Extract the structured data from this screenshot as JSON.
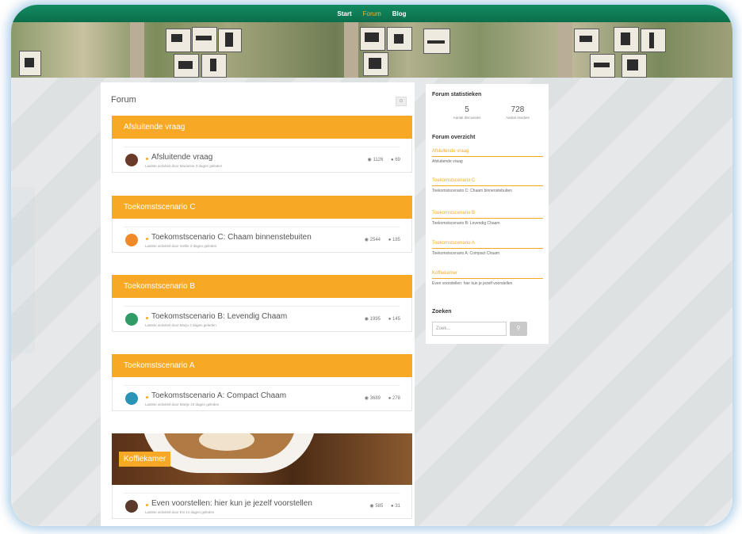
{
  "nav": {
    "items": [
      "Start",
      "Forum",
      "Blog"
    ],
    "active": "Forum"
  },
  "forum": {
    "title": "Forum",
    "rss_label": "rss",
    "categories": [
      {
        "name": "Afsluitende vraag",
        "topic": {
          "title": "Afsluitende vraag",
          "meta": "Laatste activiteit door Marianne 3 dagen geleden",
          "views": "1126",
          "replies": "69"
        }
      },
      {
        "name": "Toekomstscenario C",
        "topic": {
          "title": "Toekomstscenario C: Chaam binnenstebuiten",
          "meta": "Laatste activiteit door mellie 3 dagen geleden",
          "views": "2544",
          "replies": "185"
        }
      },
      {
        "name": "Toekomstscenario B",
        "topic": {
          "title": "Toekomstscenario B: Levendig Chaam",
          "meta": "Laatste activiteit door Marjo 3 dagen geleden",
          "views": "1995",
          "replies": "145"
        }
      },
      {
        "name": "Toekomstscenario A",
        "topic": {
          "title": "Toekomstscenario A: Compact Chaam",
          "meta": "Laatste activiteit door Marije 10 dagen geleden",
          "views": "3689",
          "replies": "278"
        }
      },
      {
        "name": "Koffiekamer",
        "topic": {
          "title": "Even voorstellen: hier kun je jezelf voorstellen",
          "meta": "Laatste activiteit door Evi 14 dagen geleden",
          "views": "585",
          "replies": "31"
        }
      }
    ]
  },
  "sidebar": {
    "stats_heading": "Forum statistieken",
    "discussions": {
      "value": "5",
      "label": "Aantal discussies"
    },
    "reactions": {
      "value": "728",
      "label": "Aantal reacties"
    },
    "overview_heading": "Forum overzicht",
    "overview": [
      {
        "title": "Afsluitende vraag",
        "desc": "Afsluitende vraag"
      },
      {
        "title": "Toekomstscenario C",
        "desc": "Toekomstscenario C: Chaam binnenstebuiten"
      },
      {
        "title": "Toekomstscenario B",
        "desc": "Toekomstscenario B: Levendig Chaam"
      },
      {
        "title": "Toekomstscenario A",
        "desc": "Toekomstscenario A: Compact Chaam"
      },
      {
        "title": "Koffiekamer",
        "desc": "Even voorstellen: hier kun je jezelf voorstellen"
      }
    ],
    "search_heading": "Zoeken",
    "search_placeholder": "Zoek...",
    "search_icon": "search-icon"
  },
  "colors": {
    "accent": "#f7a926",
    "nav_green": "#0b6e4b"
  }
}
